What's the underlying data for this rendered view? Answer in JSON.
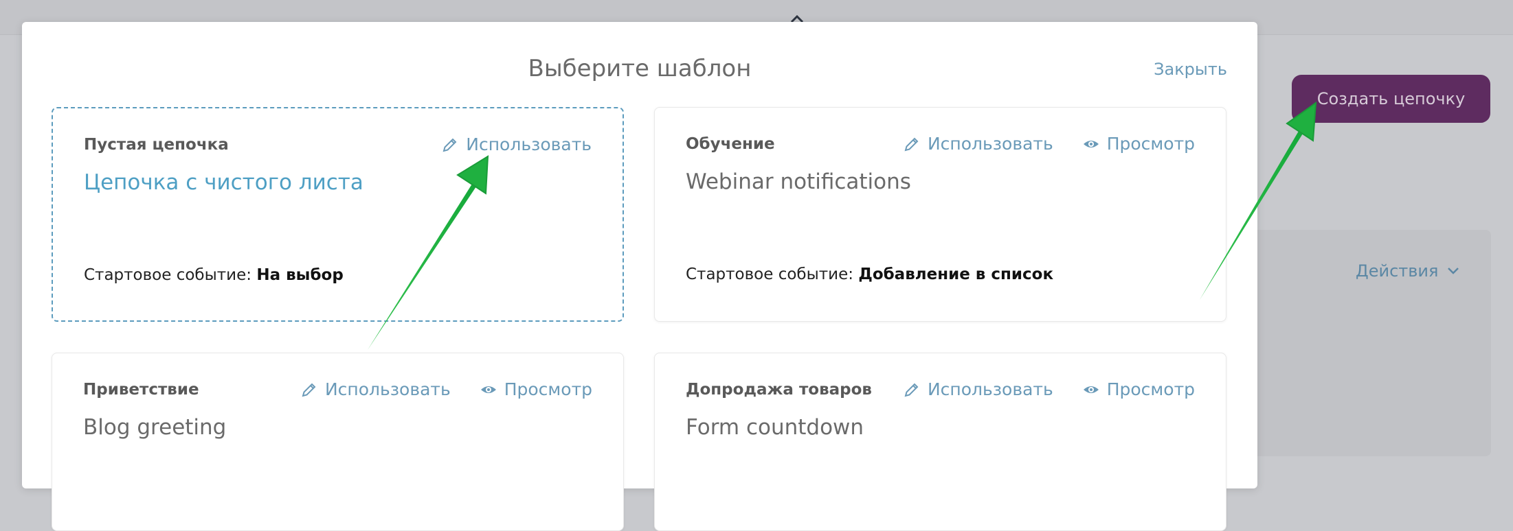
{
  "background": {
    "create_button": "Создать цепочку",
    "actions_label": "Действия"
  },
  "modal": {
    "title": "Выберите шаблон",
    "close": "Закрыть",
    "cards": [
      {
        "category": "Пустая цепочка",
        "name": "Цепочка с чистого листа",
        "use": "Использовать",
        "start_label": "Стартовое событие:",
        "start_value": "На выбор"
      },
      {
        "category": "Обучение",
        "name": "Webinar notifications",
        "use": "Использовать",
        "view": "Просмотр",
        "start_label": "Стартовое событие:",
        "start_value": "Добавление в список"
      },
      {
        "category": "Приветствие",
        "name": "Blog greeting",
        "use": "Использовать",
        "view": "Просмотр"
      },
      {
        "category": "Допродажа товаров",
        "name": "Form countdown",
        "use": "Использовать",
        "view": "Просмотр"
      }
    ]
  },
  "colors": {
    "accent": "#6a9ab8",
    "selected_name": "#4e9fc4",
    "create_button_bg": "#5e2c60",
    "arrow": "#22b445"
  }
}
